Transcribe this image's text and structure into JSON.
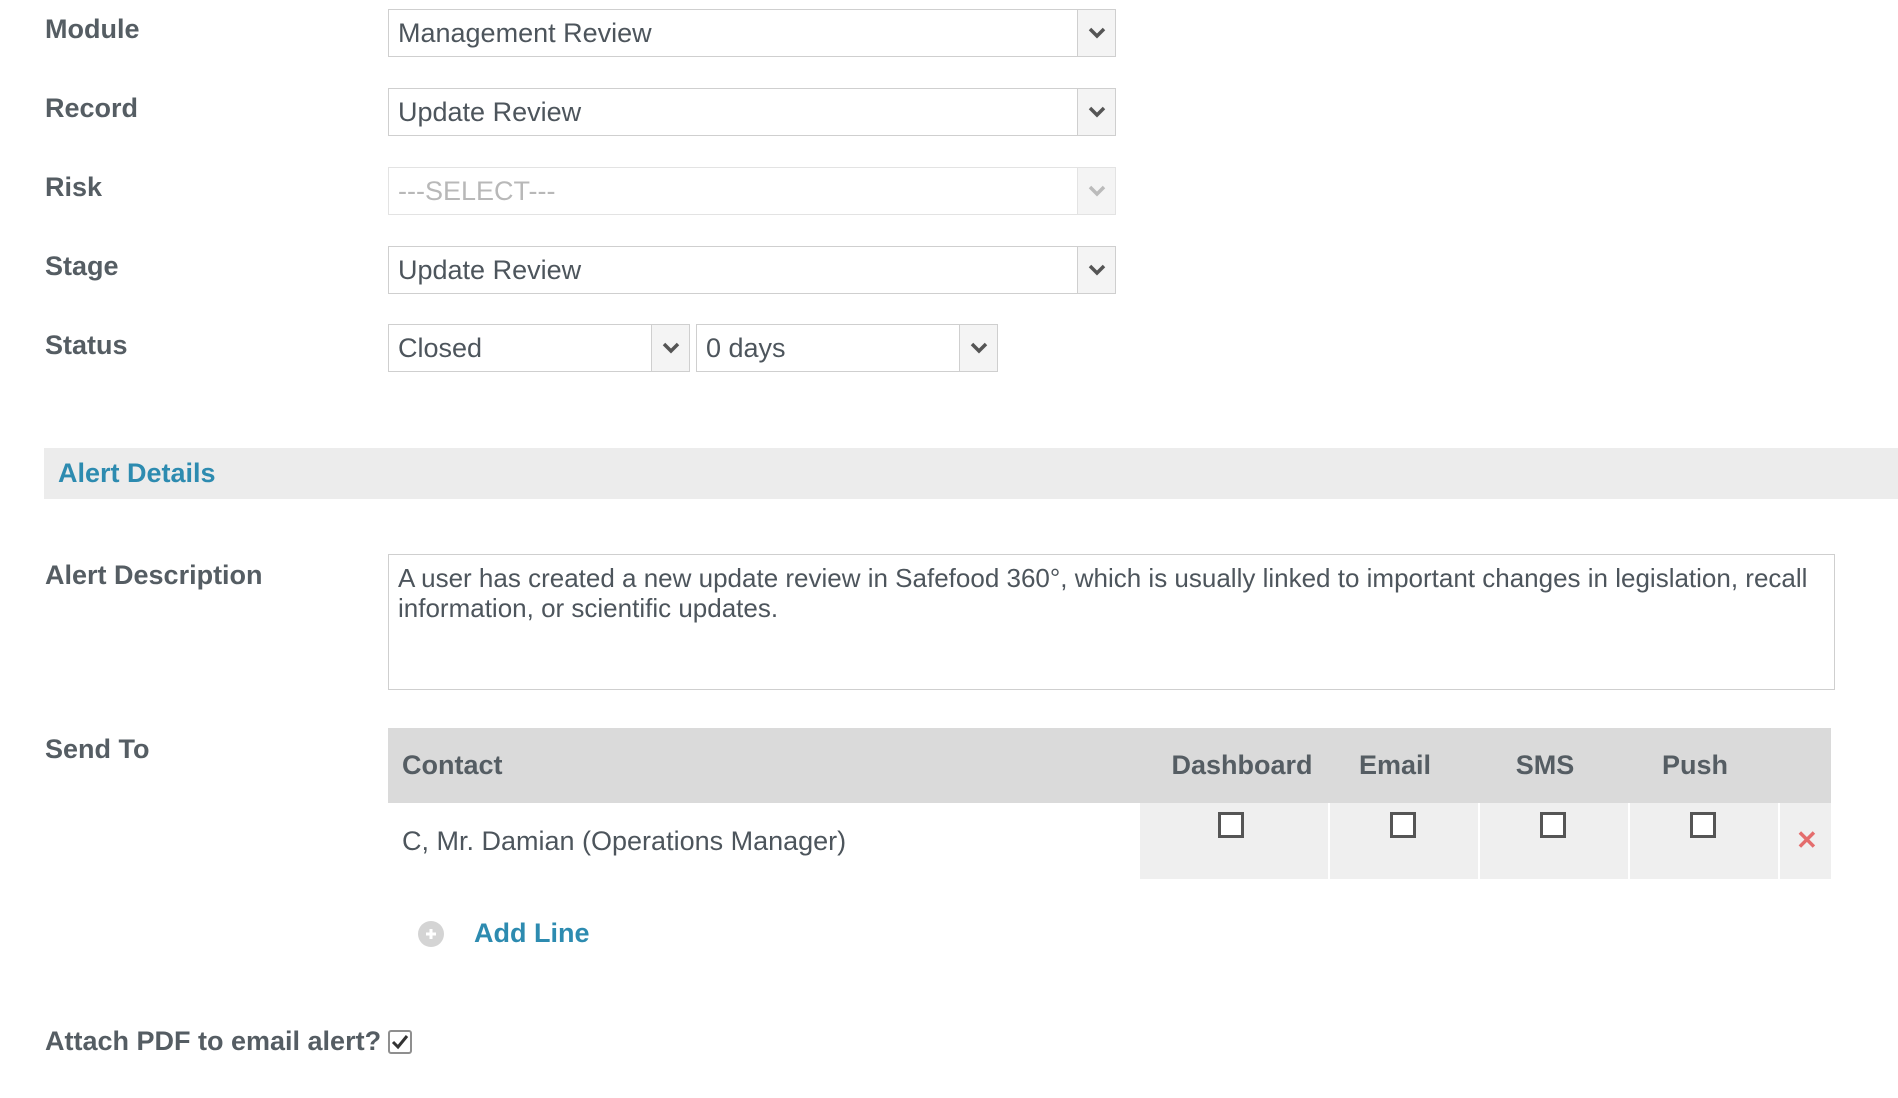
{
  "form": {
    "module": {
      "label": "Module",
      "value": "Management Review"
    },
    "record": {
      "label": "Record",
      "value": "Update Review"
    },
    "risk": {
      "label": "Risk",
      "value": "---SELECT---"
    },
    "stage": {
      "label": "Stage",
      "value": "Update Review"
    },
    "status": {
      "label": "Status",
      "value": "Closed",
      "duration": "0 days"
    }
  },
  "alert_details": {
    "section_title": "Alert Details",
    "description_label": "Alert Description",
    "description": "A user has created a new update review in Safefood 360°, which is usually linked to important changes in legislation, recall information, or scientific updates."
  },
  "send_to": {
    "label": "Send To",
    "columns": [
      "Contact",
      "Dashboard",
      "Email",
      "SMS",
      "Push"
    ],
    "rows": [
      {
        "contact": "C, Mr. Damian (Operations Manager)",
        "dashboard": false,
        "email": false,
        "sms": false,
        "push": false
      }
    ],
    "add_line_label": "Add Line"
  },
  "attach_pdf": {
    "label": "Attach PDF to email alert?",
    "checked": true
  },
  "colors": {
    "accent": "#2d8bb0",
    "delete": "#e46d6d",
    "header_bg": "#dadada",
    "section_bg": "#ececec"
  }
}
